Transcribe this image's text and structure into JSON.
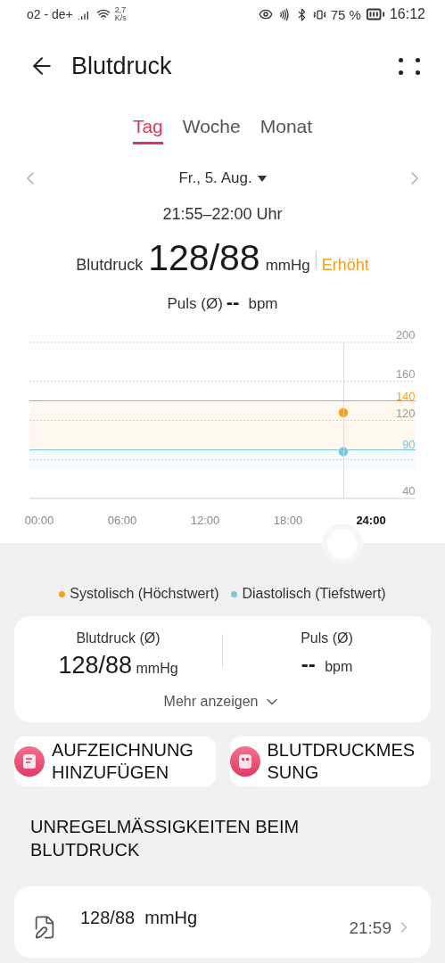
{
  "status_bar": {
    "carrier": "o2 - de+",
    "speed": "2,7",
    "speed_unit": "K/s",
    "battery": "75 %",
    "time": "16:12"
  },
  "header": {
    "title": "Blutdruck"
  },
  "tabs": [
    {
      "label": "Tag",
      "selected": true
    },
    {
      "label": "Woche",
      "selected": false
    },
    {
      "label": "Monat",
      "selected": false
    }
  ],
  "date_nav": {
    "date": "Fr., 5. Aug."
  },
  "summary": {
    "time_range": "21:55–22:00 Uhr",
    "label": "Blutdruck",
    "value": "128/88",
    "unit": "mmHg",
    "status": "Erhöht",
    "pulse_label": "Puls (Ø)",
    "pulse_value": "--",
    "pulse_unit": "bpm"
  },
  "chart": {
    "chart_data": {
      "type": "scatter",
      "x": [
        22
      ],
      "series": [
        {
          "name": "Systolisch (Höchstwert)",
          "color": "#f5a024",
          "values": [
            128
          ]
        },
        {
          "name": "Diastolisch (Tiefstwert)",
          "color": "#7ec4dc",
          "values": [
            88
          ]
        }
      ],
      "xlim": [
        -0.7,
        27.2
      ],
      "ylim": [
        40,
        200
      ],
      "xticks": [
        {
          "value": 0,
          "label": "00:00"
        },
        {
          "value": 6,
          "label": "06:00"
        },
        {
          "value": 12,
          "label": "12:00"
        },
        {
          "value": 18,
          "label": "18:00"
        },
        {
          "value": 24,
          "label": "24:00"
        }
      ],
      "yticks": [
        40,
        {
          "value": 90,
          "label": "90"
        },
        120,
        {
          "value": 140,
          "label": "140"
        },
        160,
        200
      ]
    }
  },
  "stats": {
    "bp_label": "Blutdruck (Ø)",
    "bp_value": "128/88",
    "bp_unit": "mmHg",
    "pulse_label": "Puls (Ø)",
    "pulse_value": "--",
    "pulse_unit": "bpm",
    "more": "Mehr anzeigen"
  },
  "actions": [
    {
      "kind": "record",
      "lines": [
        "AUFZEICHNUNG",
        "HINZUFÜGEN"
      ]
    },
    {
      "kind": "measure",
      "lines": [
        "BLUTDRUCKMES",
        "SUNG"
      ]
    }
  ],
  "section_title": "UNREGELMÄSSIGKEITEN BEIM BLUTDRUCK",
  "records": [
    {
      "value": "128/88  mmHg",
      "time": "21:59"
    }
  ]
}
